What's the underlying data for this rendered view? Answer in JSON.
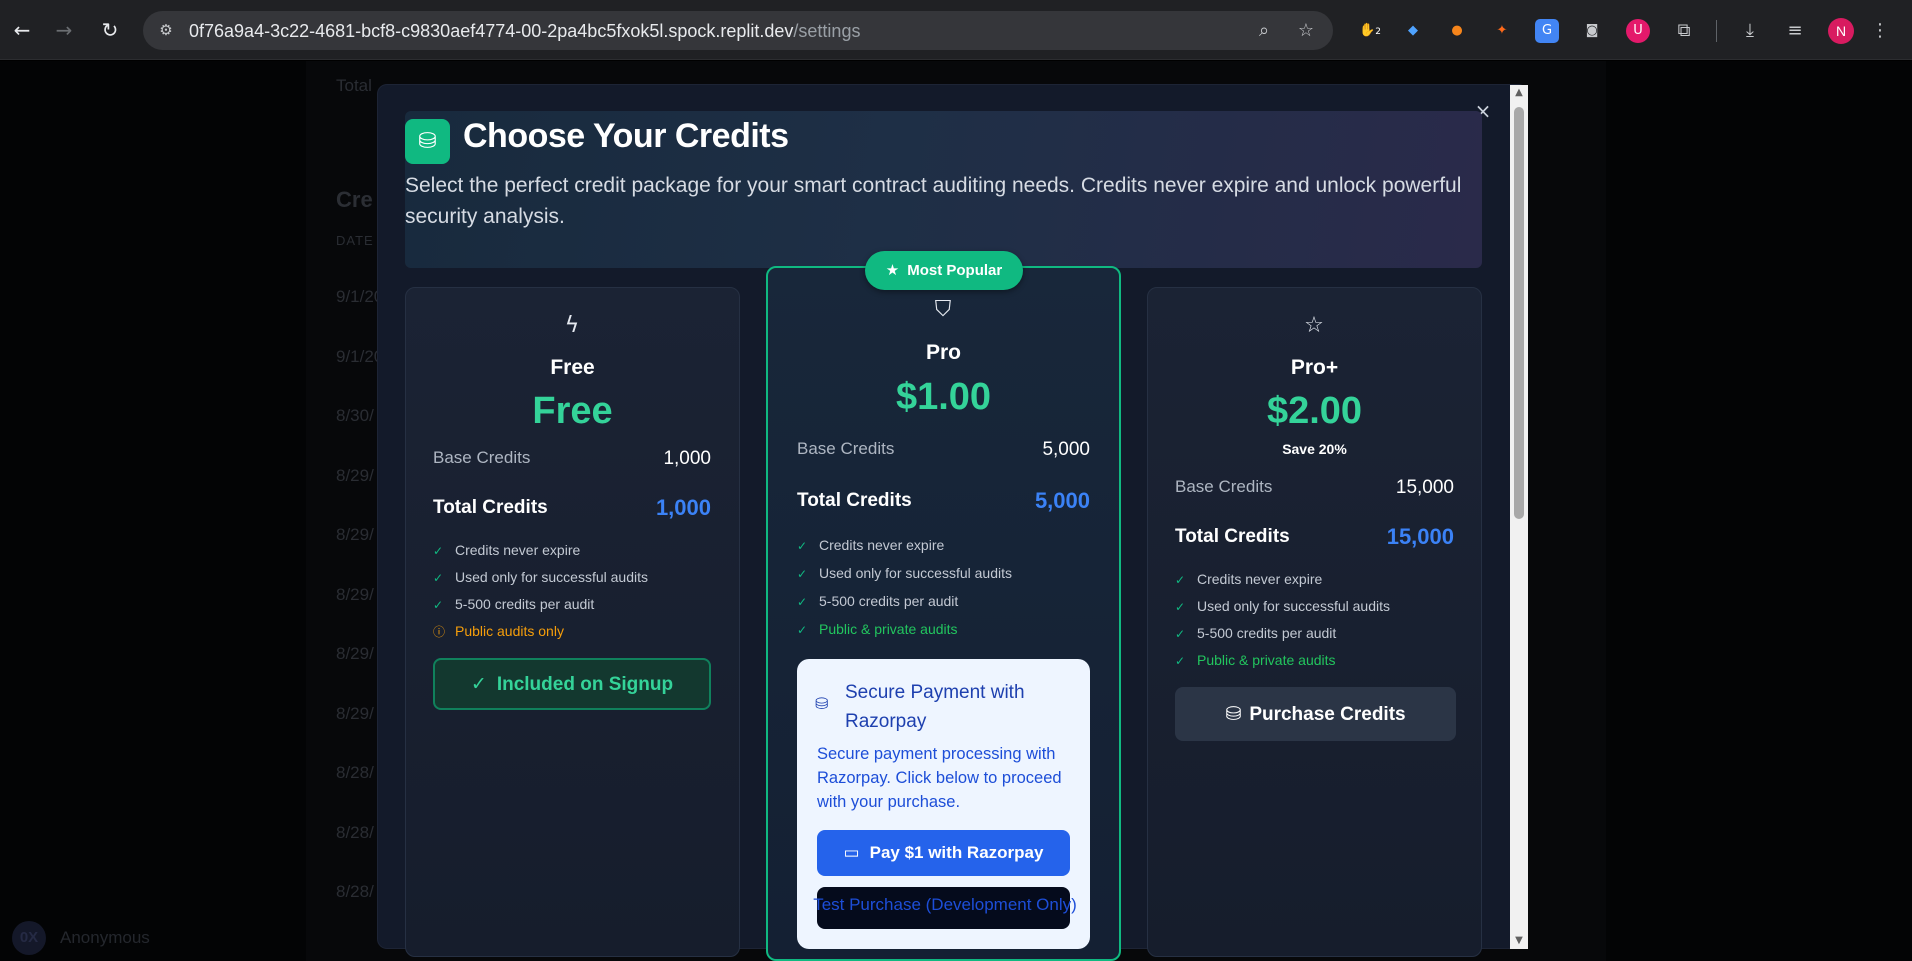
{
  "browser": {
    "url_host": "0f76a9a4-3c22-4681-bcf8-c9830aef4774-00-2pa4bc5fxok5l.spock.replit.dev",
    "url_path": "/settings",
    "extension_badge": "2",
    "profile_initial": "N"
  },
  "background": {
    "partial_total": "Total",
    "section_heading": "Cre",
    "date_header": "DATE",
    "rows": [
      "9/1/20",
      "9/1/20",
      "8/30/",
      "8/29/",
      "8/29/",
      "8/29/",
      "8/29/",
      "8/29/",
      "8/28/",
      "8/28/",
      "8/28/"
    ],
    "user_initials": "0X",
    "user_name": "Anonymous"
  },
  "modal": {
    "title": "Choose Your Credits",
    "description": "Select the perfect credit package for your smart contract auditing needs. Credits never expire and unlock powerful security analysis.",
    "popular_badge": "Most Popular",
    "plans": [
      {
        "name": "Free",
        "price": "Free",
        "base_label": "Base Credits",
        "base_value": "1,000",
        "total_label": "Total Credits",
        "total_value": "1,000",
        "features": [
          "Credits never expire",
          "Used only for successful audits",
          "5-500 credits per audit",
          "Public audits only"
        ],
        "button": "Included on Signup"
      },
      {
        "name": "Pro",
        "price": "$1.00",
        "base_label": "Base Credits",
        "base_value": "5,000",
        "total_label": "Total Credits",
        "total_value": "5,000",
        "features": [
          "Credits never expire",
          "Used only for successful audits",
          "5-500 credits per audit",
          "Public & private audits"
        ]
      },
      {
        "name": "Pro+",
        "price": "$2.00",
        "save": "Save 20%",
        "base_label": "Base Credits",
        "base_value": "15,000",
        "total_label": "Total Credits",
        "total_value": "15,000",
        "features": [
          "Credits never expire",
          "Used only for successful audits",
          "5-500 credits per audit",
          "Public & private audits"
        ],
        "button": "Purchase Credits"
      }
    ],
    "payment": {
      "title": "Secure Payment with Razorpay",
      "description": "Secure payment processing with Razorpay. Click below to proceed with your purchase.",
      "pay_button": "Pay $1 with Razorpay",
      "test_button": "Test Purchase (Development Only)"
    }
  },
  "colors": {
    "accent_green": "#10b981",
    "credit_blue": "#3b82f6",
    "razorpay_blue": "#2563eb",
    "warning": "#f59e0b"
  }
}
